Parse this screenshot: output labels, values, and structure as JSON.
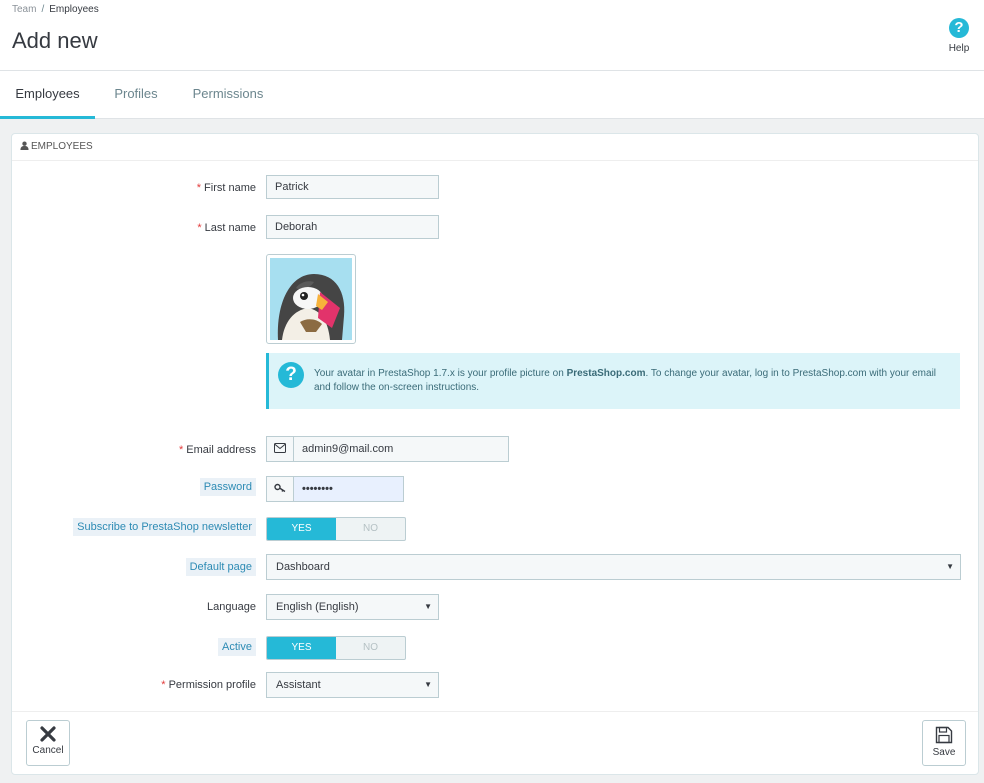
{
  "breadcrumb": {
    "parent": "Team",
    "separator": "/",
    "current": "Employees"
  },
  "page": {
    "title": "Add new"
  },
  "help": {
    "label": "Help",
    "glyph": "?"
  },
  "tabs": [
    {
      "label": "Employees",
      "active": true
    },
    {
      "label": "Profiles",
      "active": false
    },
    {
      "label": "Permissions",
      "active": false
    }
  ],
  "panel": {
    "heading": "Employees",
    "heading_icon": "user-icon"
  },
  "form": {
    "required_mark": "*",
    "first_name": {
      "label": "First name",
      "value": "Patrick"
    },
    "last_name": {
      "label": "Last name",
      "value": "Deborah"
    },
    "avatar_alert": {
      "pre": "Your avatar in PrestaShop 1.7.x is your profile picture on ",
      "strong": "PrestaShop.com",
      "post": ". To change your avatar, log in to PrestaShop.com with your email and follow the on-screen instructions."
    },
    "email": {
      "label": "Email address",
      "value": "admin9@mail.com",
      "icon": "envelope-icon"
    },
    "password": {
      "label": "Password",
      "value": "••••••••",
      "icon": "key-icon"
    },
    "newsletter": {
      "label": "Subscribe to PrestaShop newsletter",
      "yes": "YES",
      "no": "NO",
      "selected": "YES"
    },
    "default_page": {
      "label": "Default page",
      "value": "Dashboard"
    },
    "language": {
      "label": "Language",
      "value": "English (English)"
    },
    "active": {
      "label": "Active",
      "yes": "YES",
      "no": "NO",
      "selected": "YES"
    },
    "permission_profile": {
      "label": "Permission profile",
      "value": "Assistant"
    }
  },
  "footer": {
    "cancel_label": "Cancel",
    "cancel_icon": "close-icon",
    "save_label": "Save",
    "save_icon": "floppy-disk-icon"
  },
  "colors": {
    "accent": "#25b9d7",
    "required": "#e23b3b",
    "alert_bg": "#dcf4f9"
  }
}
